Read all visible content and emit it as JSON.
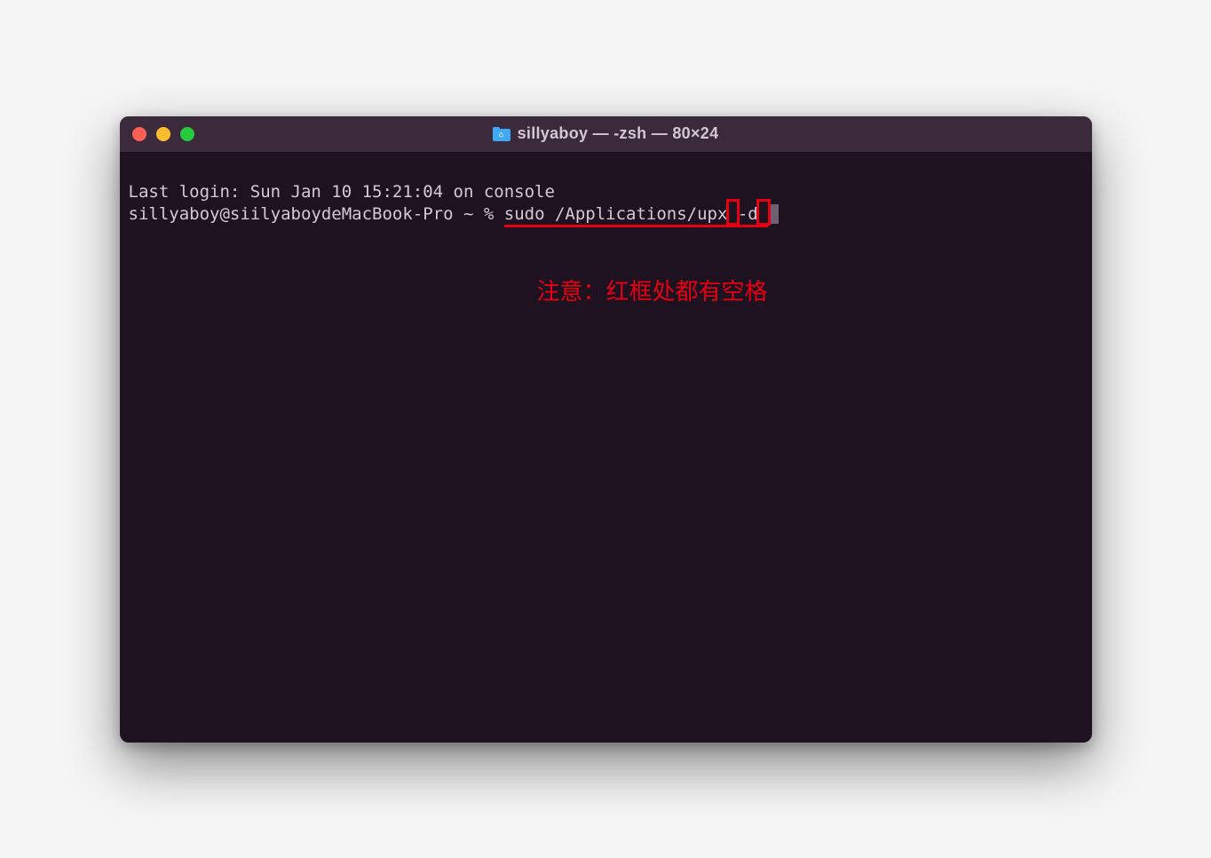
{
  "window": {
    "title": "sillyaboy — -zsh — 80×24"
  },
  "terminal": {
    "line1": "Last login: Sun Jan 10 15:21:04 on console",
    "prompt": "sillyaboy@siilyaboydeMacBook-Pro ~ % ",
    "command": "sudo /Applications/upx -d "
  },
  "annotation": {
    "text": "注意：红框处都有空格"
  },
  "icons": {
    "folder": "folder-icon"
  }
}
